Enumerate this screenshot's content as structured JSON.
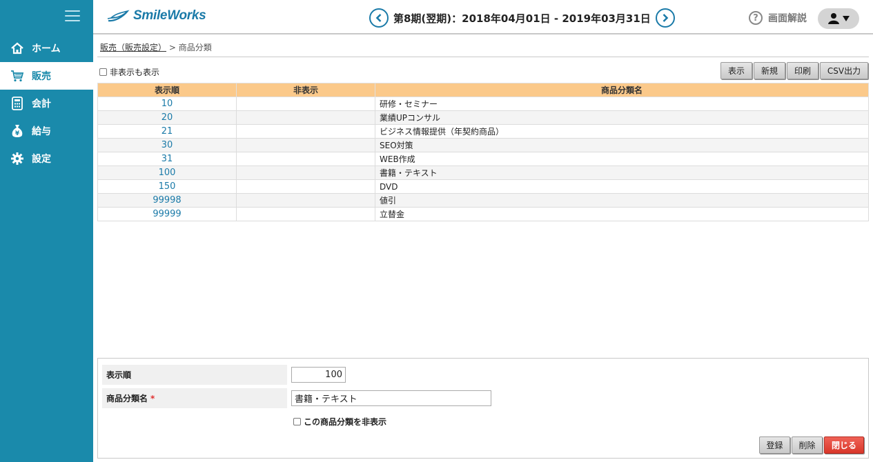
{
  "colors": {
    "sidebar": "#1a8aab",
    "accent": "#1a7aa8",
    "table_header": "#fbc98a",
    "close_button": "#e04538"
  },
  "sidebar": {
    "menu_icon": "hamburger-icon",
    "items": [
      {
        "label": "ホーム",
        "icon": "home-icon",
        "active": false
      },
      {
        "label": "販売",
        "icon": "cart-icon",
        "active": true
      },
      {
        "label": "会計",
        "icon": "calculator-icon",
        "active": false
      },
      {
        "label": "給与",
        "icon": "money-bag-icon",
        "active": false
      },
      {
        "label": "設定",
        "icon": "gear-icon",
        "active": false
      }
    ]
  },
  "header": {
    "logo": "SmileWorks",
    "period": "第8期(翌期)：2018年04月01日 - 2019年03月31日",
    "help": "画面解説"
  },
  "breadcrumb": {
    "parent": "販売（販売設定）",
    "separator": ">",
    "current": "商品分類"
  },
  "toolbar": {
    "show_hidden": "非表示も表示",
    "buttons": {
      "show": "表示",
      "new": "新規",
      "print": "印刷",
      "csv": "CSV出力"
    }
  },
  "table": {
    "headers": {
      "order": "表示順",
      "hidden": "非表示",
      "name": "商品分類名"
    },
    "rows": [
      {
        "order": "10",
        "hidden": "",
        "name": "研修・セミナー"
      },
      {
        "order": "20",
        "hidden": "",
        "name": "業績UPコンサル"
      },
      {
        "order": "21",
        "hidden": "",
        "name": "ビジネス情報提供（年契約商品）"
      },
      {
        "order": "30",
        "hidden": "",
        "name": "SEO対策"
      },
      {
        "order": "31",
        "hidden": "",
        "name": "WEB作成"
      },
      {
        "order": "100",
        "hidden": "",
        "name": "書籍・テキスト"
      },
      {
        "order": "150",
        "hidden": "",
        "name": "DVD"
      },
      {
        "order": "99998",
        "hidden": "",
        "name": "値引"
      },
      {
        "order": "99999",
        "hidden": "",
        "name": "立替金"
      }
    ]
  },
  "form": {
    "order_label": "表示順",
    "order_value": "100",
    "name_label": "商品分類名",
    "required_mark": "*",
    "name_value": "書籍・テキスト",
    "hide_label": "この商品分類を非表示",
    "buttons": {
      "register": "登録",
      "delete": "削除",
      "close": "閉じる"
    }
  }
}
